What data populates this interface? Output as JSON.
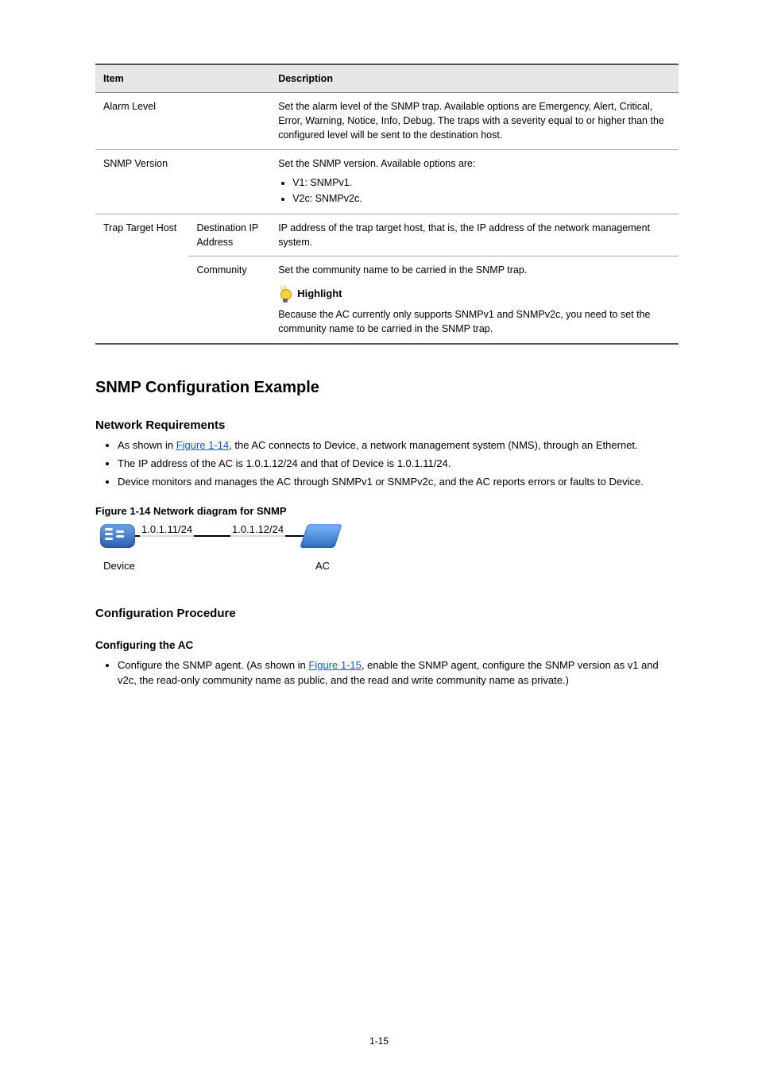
{
  "page_number": "1-15",
  "table": {
    "headers": {
      "item": "Item",
      "description": "Description"
    },
    "rows": [
      {
        "item": "Alarm Level",
        "description": "Set the alarm level of the SNMP trap. Available options are Emergency, Alert, Critical, Error, Warning, Notice, Info, Debug. The traps with a severity equal to or higher than the configured level will be sent to the destination host."
      },
      {
        "item": "SNMP Version",
        "description_intro": "Set the SNMP version. Available options are:",
        "bullets": [
          "V1: SNMPv1.",
          "V2c: SNMPv2c."
        ]
      }
    ],
    "nested": {
      "group_label": "Trap Target Host",
      "rows": [
        {
          "sub": "Destination IP Address",
          "description": "IP address of the trap target host, that is, the IP address of the network management system."
        },
        {
          "sub": "Community",
          "description": "Set the community name to be carried in the SNMP trap.",
          "highlight_label": "Highlight",
          "highlight_note": "Because the AC currently only supports SNMPv1 and SNMPv2c, you need to set the community name to be carried in the SNMP trap."
        }
      ]
    }
  },
  "example": {
    "heading": "SNMP Configuration Example",
    "req_heading": "Network Requirements",
    "requirements": [
      {
        "prefix": "As shown in ",
        "link": "Figure 1-14",
        "suffix": ", the AC connects to Device, a network management system (NMS), through an Ethernet."
      },
      {
        "text": "The IP address of the AC is 1.0.1.12/24 and that of Device is 1.0.1.11/24."
      },
      {
        "text": "Device monitors and manages the AC through SNMPv1 or SNMPv2c, and the AC reports errors or faults to Device."
      }
    ],
    "figure": {
      "caption": "Figure 1-14 Network diagram for SNMP",
      "ip_left": "1.0.1.11/24",
      "ip_right": "1.0.1.12/24",
      "left_label": "Device",
      "right_label": "AC"
    },
    "proc_heading": "Configuration Procedure",
    "proc_sub_heading": "Configuring the AC",
    "step1": {
      "prefix": "Configure the SNMP agent. (As shown in ",
      "link": "Figure 1-15",
      "suffix": ", enable the SNMP agent, configure the SNMP version as v1 and v2c, the read-only community name as public, and the read and write community name as private.)"
    }
  }
}
